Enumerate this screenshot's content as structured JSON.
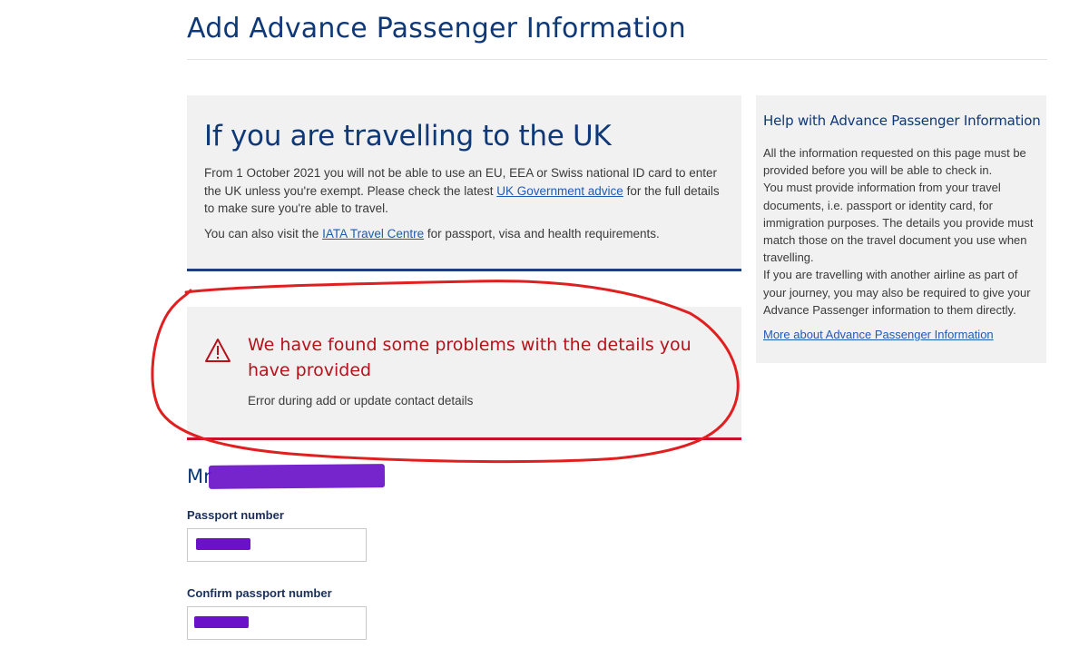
{
  "page": {
    "title": "Add Advance Passenger Information"
  },
  "uk_notice": {
    "heading": "If you are travelling to the UK",
    "para1_before": "From 1 October 2021 you will not be able to use an EU, EEA or Swiss national ID card to enter the UK unless you're exempt. Please check the latest ",
    "para1_link": "UK Government advice",
    "para1_after": " for the full details to make sure you're able to travel.",
    "para2_before": "You can also visit the ",
    "para2_link": "IATA Travel Centre",
    "para2_after": " for passport, visa and health requirements."
  },
  "error": {
    "icon": "warning-triangle-icon",
    "heading": "We have found some problems with the details you have provided",
    "detail": "Error during add or update contact details"
  },
  "help": {
    "heading": "Help with Advance Passenger Information",
    "p1": "All the information requested on this page must be provided before you will be able to check in.",
    "p2": "You must provide information from your travel documents, i.e. passport or identity card, for immigration purposes. The details you provide must match those on the travel document you use when travelling.",
    "p3": "If you are travelling with another airline as part of your journey, you may also be required to give your Advance Passenger information to them directly.",
    "link": "More about Advance Passenger Information"
  },
  "passenger": {
    "name_visible": "Mr"
  },
  "form": {
    "passport_label": "Passport number",
    "confirm_label": "Confirm passport number"
  },
  "colors": {
    "heading_blue": "#0f3877",
    "error_red": "#b5121b",
    "panel_bg": "#f1f1f1",
    "annotation_red": "#e02020",
    "redaction_purple": "#6a12c9"
  }
}
